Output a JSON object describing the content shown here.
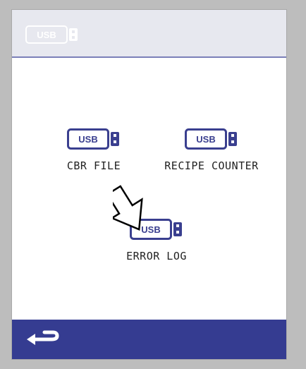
{
  "header": {
    "usb_badge": "USB",
    "icon": "usb-drive-icon"
  },
  "items": [
    {
      "label": "CBR FILE",
      "badge": "USB",
      "icon": "usb-drive-icon"
    },
    {
      "label": "RECIPE COUNTER",
      "badge": "USB",
      "icon": "usb-drive-icon"
    },
    {
      "label": "ERROR LOG",
      "badge": "USB",
      "icon": "usb-drive-icon"
    }
  ],
  "pointer": {
    "icon": "pointing-arrow-icon"
  },
  "footer": {
    "back_icon": "back-arrow-icon"
  },
  "colors": {
    "brand_navy": "#353c91",
    "usb_outline": "#3a3f8f",
    "header_bg": "#e7e8ef",
    "header_usb": "#ffffff"
  }
}
